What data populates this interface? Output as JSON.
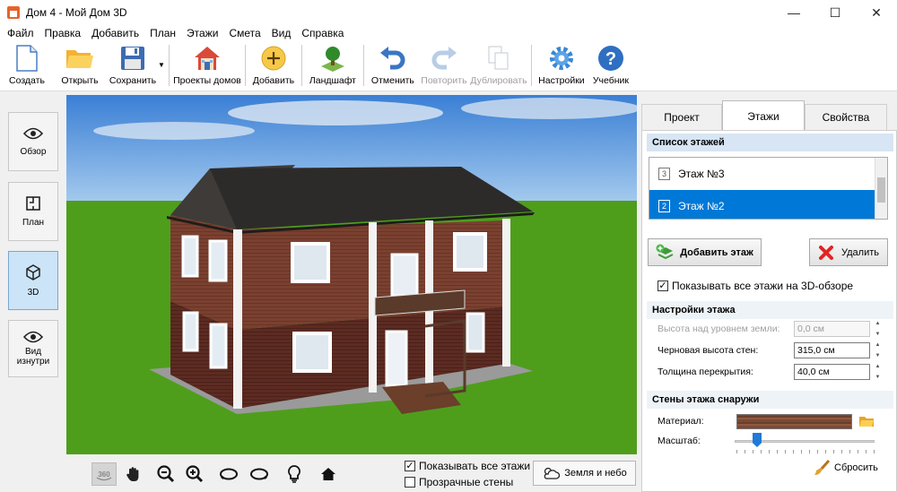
{
  "window": {
    "title": "Дом 4 - Мой Дом 3D",
    "minimize": "—",
    "maximize": "☐",
    "close": "✕"
  },
  "menu": [
    "Файл",
    "Правка",
    "Добавить",
    "План",
    "Этажи",
    "Смета",
    "Вид",
    "Справка"
  ],
  "toolbar": {
    "create": "Создать",
    "open": "Открыть",
    "save": "Сохранить",
    "projects": "Проекты домов",
    "add": "Добавить",
    "landscape": "Ландшафт",
    "undo": "Отменить",
    "redo": "Повторить",
    "duplicate": "Дублировать",
    "settings": "Настройки",
    "tutorial": "Учебник"
  },
  "views": {
    "overview": "Обзор",
    "plan": "План",
    "view3d": "3D",
    "inside": "Вид изнутри",
    "active": "3D"
  },
  "viewport": {
    "sky_top": "#3a7fd5",
    "sky_bottom": "#a9cdef",
    "grass": "#4e9e1c",
    "show_all_floors": "Показывать все этажи",
    "show_all_floors_checked": true,
    "transparent_walls": "Прозрачные стены",
    "transparent_walls_checked": false,
    "earth_sky_button": "Земля и небо",
    "nav_icons": [
      "rotate-360-icon",
      "hand-pan-icon",
      "zoom-out-icon",
      "zoom-in-icon",
      "rotate-left-icon",
      "rotate-right-icon",
      "light-bulb-icon",
      "home-icon"
    ]
  },
  "panel": {
    "tabs": [
      "Проект",
      "Этажи",
      "Свойства"
    ],
    "active_tab": "Этажи",
    "floor_list_title": "Список этажей",
    "floors": [
      {
        "num": "3",
        "name": "Этаж №3",
        "selected": false
      },
      {
        "num": "2",
        "name": "Этаж №2",
        "selected": true
      }
    ],
    "add_floor": "Добавить этаж",
    "delete": "Удалить",
    "show_all_3d": "Показывать все этажи на 3D-обзоре",
    "show_all_3d_checked": true,
    "floor_settings_title": "Настройки этажа",
    "height_above_ground_label": "Высота над уровнем земли:",
    "height_above_ground_value": "0,0 см",
    "rough_wall_height_label": "Черновая высота стен:",
    "rough_wall_height_value": "315,0 см",
    "slab_thickness_label": "Толщина перекрытия:",
    "slab_thickness_value": "40,0 см",
    "exterior_walls_title": "Стены этажа снаружи",
    "material_label": "Материал:",
    "scale_label": "Масштаб:",
    "reset": "Сбросить"
  }
}
